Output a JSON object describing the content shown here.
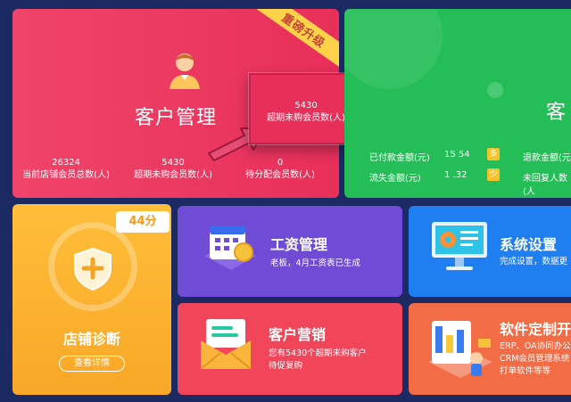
{
  "customer_card": {
    "ribbon": "重磅升级",
    "title": "客户管理",
    "stats": [
      {
        "value": "26324",
        "label": "当前店铺会员总数(人)"
      },
      {
        "value": "5430",
        "label": "超期未购会员数(人)"
      },
      {
        "value": "0",
        "label": "待分配会员数(人)"
      }
    ],
    "highlight": {
      "value": "5430",
      "label": "超期未购会员数(人)"
    }
  },
  "green_card": {
    "title_partial": "客",
    "rows": [
      {
        "label": "已付款金额(元)",
        "value": "15 54",
        "tag": "多",
        "right_label": "退款金额(元)"
      },
      {
        "label": "流失金额(元)",
        "value": "1 .32",
        "tag": "少",
        "right_label": "未回复人数(人"
      }
    ]
  },
  "shop_card": {
    "score": "44分",
    "title": "店铺诊断",
    "button": "查看详情"
  },
  "salary_card": {
    "title": "工资管理",
    "desc": "老板，4月工资表已生成"
  },
  "marketing_card": {
    "title": "客户营销",
    "desc_line1": "您有5430个超期未购客户",
    "desc_line2": "待促复购"
  },
  "settings_card": {
    "title": "系统设置",
    "desc": "完成设置，数据更"
  },
  "custom_card": {
    "title": "软件定制开",
    "desc_line1": "ERP、OA协同办公",
    "desc_line2": "CRM会员管理系统",
    "desc_line3": "打单软件等等"
  },
  "colors": {
    "customer": "#e72f5a",
    "green": "#24bd57",
    "shop": "#f8a727",
    "salary": "#6f4bd6",
    "marketing": "#f1455a",
    "settings": "#1f7ef0",
    "custom": "#f26c46",
    "page_bg": "#1c2a63"
  }
}
